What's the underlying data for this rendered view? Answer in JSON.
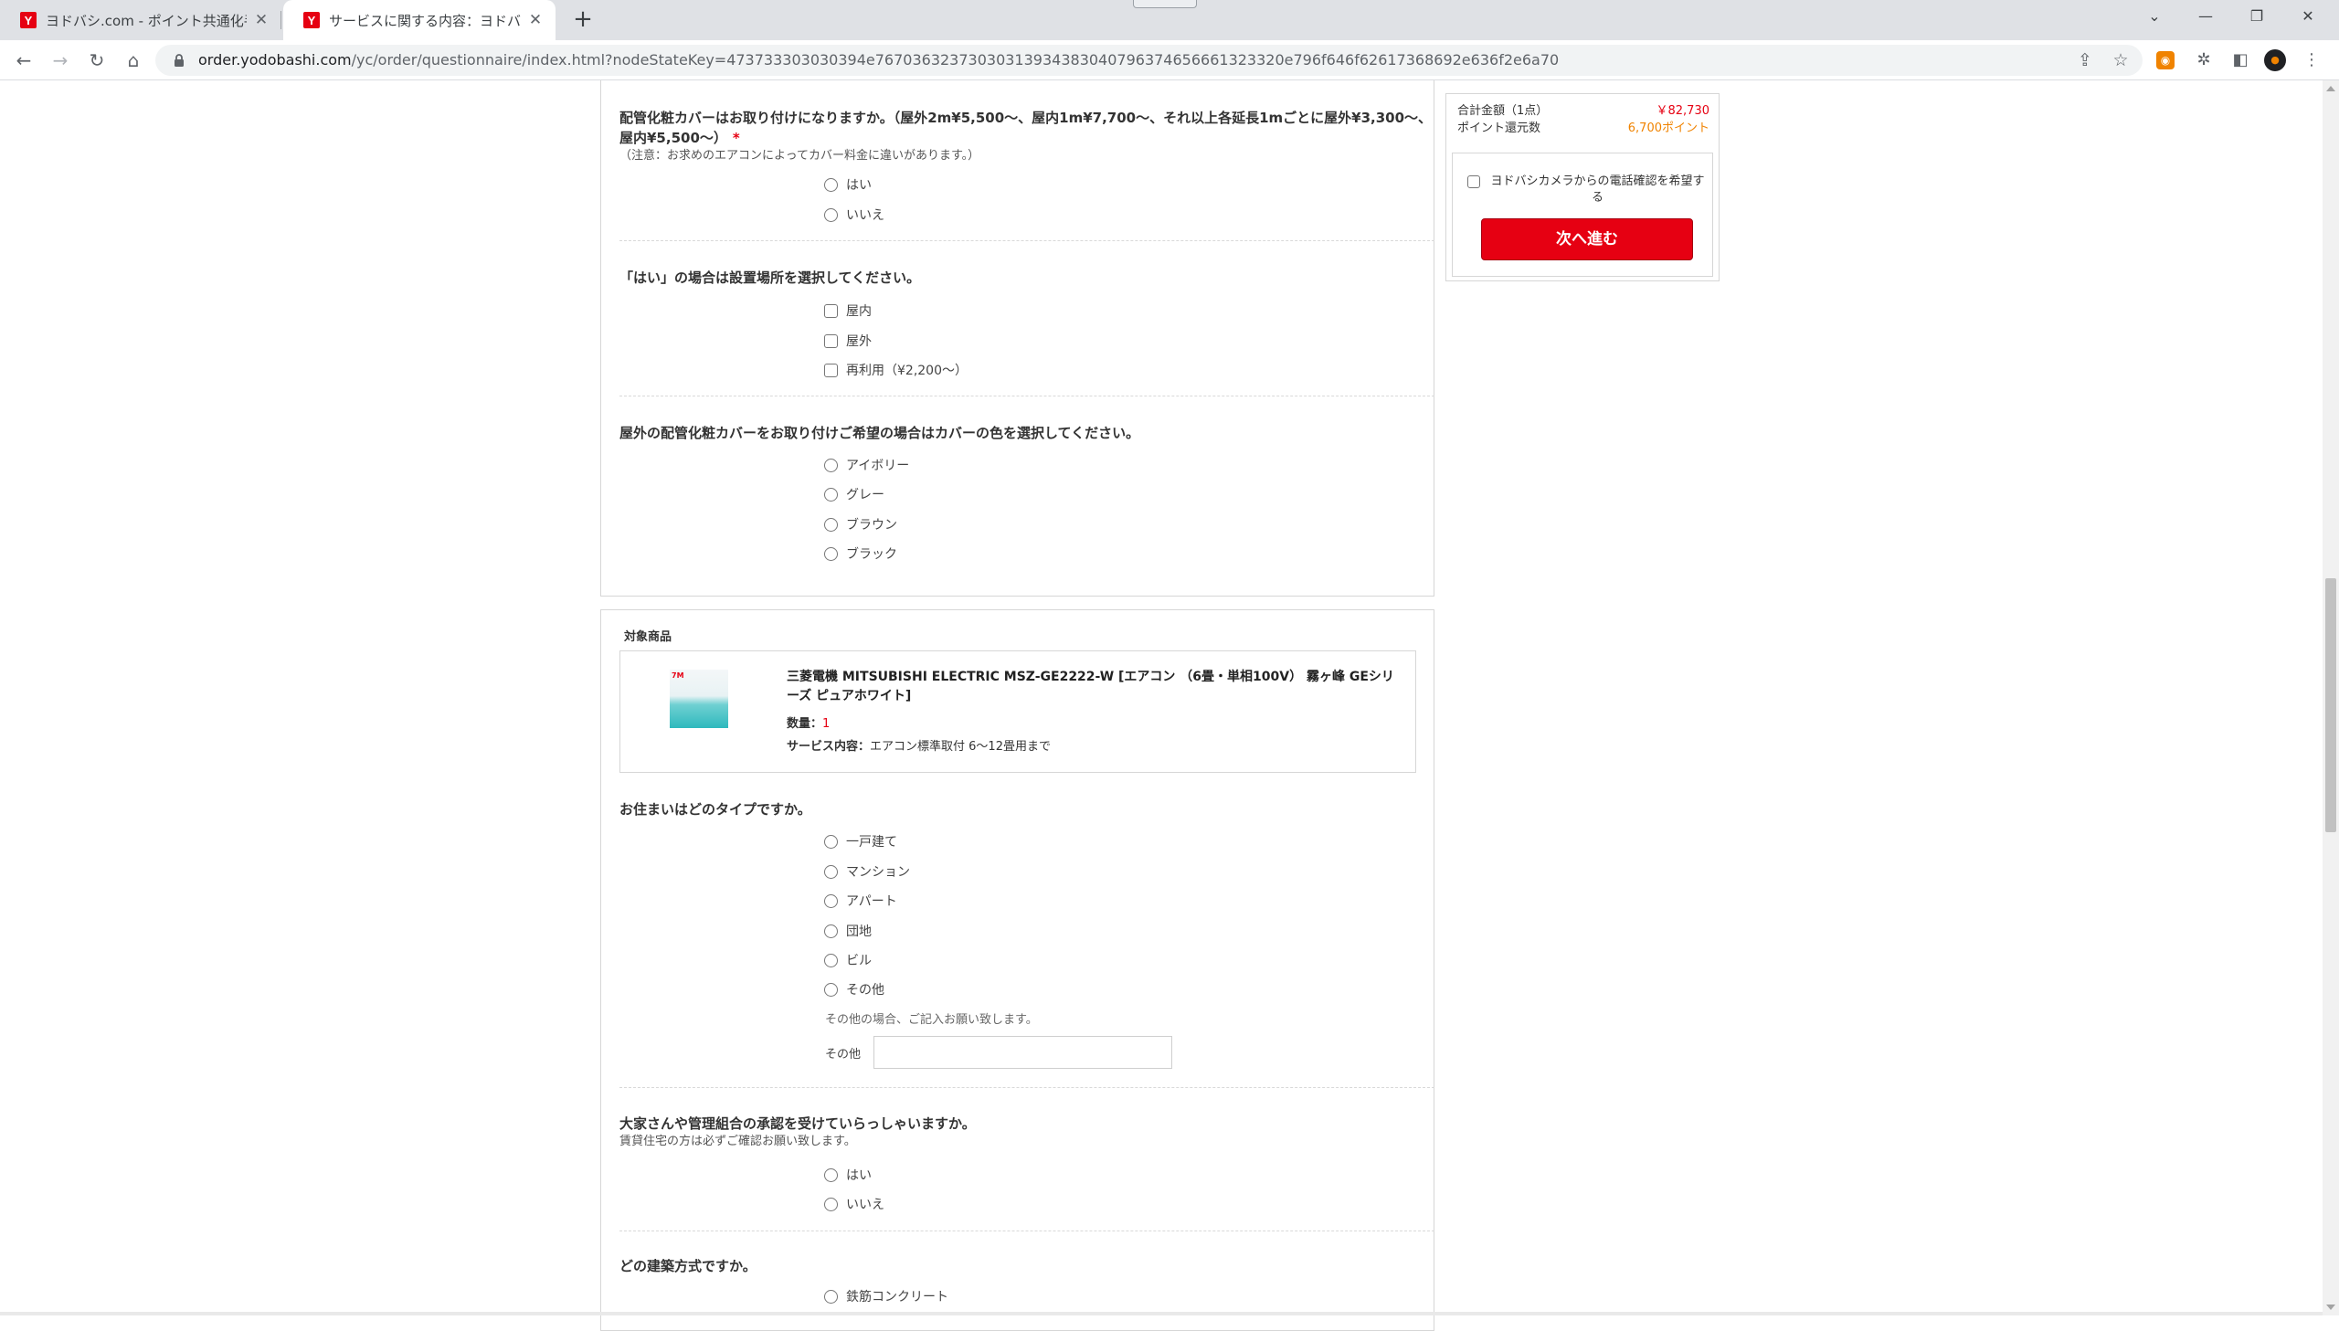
{
  "browser": {
    "tabs": [
      {
        "title": "ヨドバシ.com - ポイント共通化手続き",
        "active": false
      },
      {
        "title": "サービスに関する内容：ヨドバシ・ドットコム",
        "active": true
      }
    ],
    "new_tab": "+",
    "url_host": "order.yodobashi.com",
    "url_path": "/yc/order/questionnaire/index.html?nodeStateKey=473733303030394e76703632373030313934383040796374656661323320e796f646f62617368692e636f2e6a70",
    "favicon_color": "#e60012"
  },
  "questions": {
    "cover": {
      "title": "配管化粧カバーはお取り付けになりますか。（屋外2m¥5,500〜、屋内1m¥7,700〜、それ以上各延長1mごとに屋外¥3,300〜、屋内¥5,500〜）",
      "required_mark": "*",
      "note": "（注意：お求めのエアコンによってカバー料金に違いがあります。）",
      "options": [
        "はい",
        "いいえ"
      ]
    },
    "location": {
      "title": "「はい」の場合は設置場所を選択してください。",
      "options": [
        "屋内",
        "屋外",
        "再利用（¥2,200〜）"
      ]
    },
    "color": {
      "title": "屋外の配管化粧カバーをお取り付けご希望の場合はカバーの色を選択してください。",
      "options": [
        "アイボリー",
        "グレー",
        "ブラウン",
        "ブラック"
      ]
    },
    "housing": {
      "title": "お住まいはどのタイプですか。",
      "options": [
        "一戸建て",
        "マンション",
        "アパート",
        "団地",
        "ビル",
        "その他"
      ],
      "other_hint": "その他の場合、ご記入お願い致します。",
      "other_label": "その他",
      "other_value": ""
    },
    "approval": {
      "title": "大家さんや管理組合の承認を受けていらっしゃいますか。",
      "note": "賃貸住宅の方は必ずご確認お願い致します。",
      "options": [
        "はい",
        "いいえ"
      ]
    },
    "construction": {
      "title": "どの建築方式ですか。",
      "options": [
        "鉄筋コンクリート"
      ]
    }
  },
  "target_product": {
    "section_label": "対象商品",
    "name": "三菱電機 MITSUBISHI ELECTRIC MSZ-GE2222-W [エアコン （6畳・単相100V） 霧ヶ峰 GEシリーズ ピュアホワイト]",
    "quantity_label": "数量：",
    "quantity": "1",
    "service_label": "サービス内容：",
    "service": "エアコン標準取付 6〜12畳用まで"
  },
  "summary": {
    "total_label": "合計金額（1点）",
    "total_value": "￥82,730",
    "points_label": "ポイント還元数",
    "points_value": "6,700ポイント",
    "phone_confirm_label": "ヨドバシカメラからの電話確認を希望する",
    "next_label": "次へ進む",
    "accent_red": "#e60012",
    "accent_orange": "#f08300"
  }
}
